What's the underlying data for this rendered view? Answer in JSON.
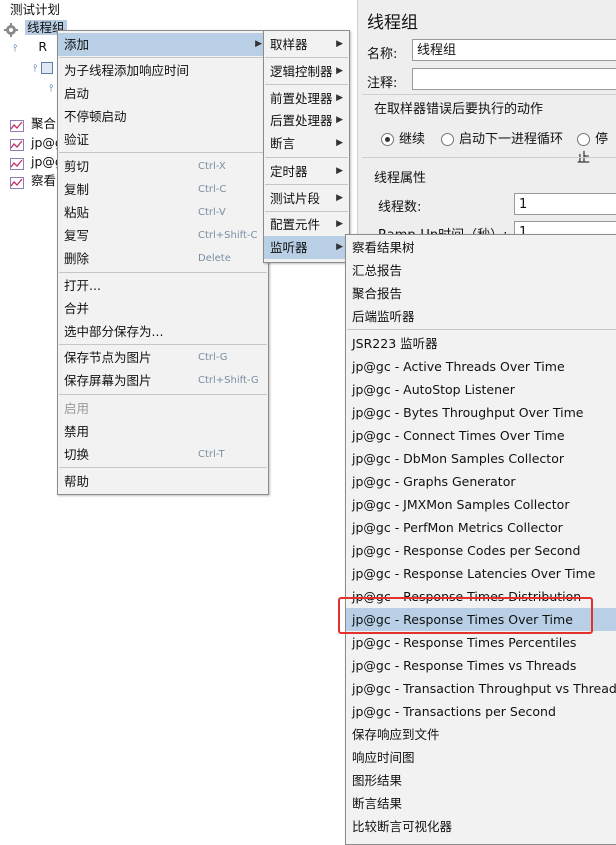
{
  "tree": {
    "items": [
      {
        "label": "测试计划"
      },
      {
        "label": "线程组"
      },
      {
        "label": "R"
      },
      {
        "label": ""
      },
      {
        "label": ""
      },
      {
        "label": "聚合"
      },
      {
        "label": "jp@g"
      },
      {
        "label": "jp@g"
      },
      {
        "label": "察看"
      }
    ]
  },
  "panel": {
    "title": "线程组",
    "name_label": "名称:",
    "name_value": "线程组",
    "comment_label": "注释:",
    "comment_value": "",
    "error_action_label": "在取样器错误后要执行的动作",
    "radio_continue": "继续",
    "radio_next_loop": "启动下一进程循环",
    "radio_stop": "停止",
    "thread_props_label": "线程属性",
    "threads_label": "线程数:",
    "threads_value": "1",
    "rampup_label": "Ramp-Up时间（秒）:",
    "rampup_value": "1"
  },
  "menu_main": {
    "items": [
      {
        "label": "添加"
      },
      {
        "label": "为子线程添加响应时间"
      },
      {
        "label": "启动"
      },
      {
        "label": "不停顿启动"
      },
      {
        "label": "验证"
      },
      {
        "label": "剪切",
        "shortcut": "Ctrl-X"
      },
      {
        "label": "复制",
        "shortcut": "Ctrl-C"
      },
      {
        "label": "粘贴",
        "shortcut": "Ctrl-V"
      },
      {
        "label": "复写",
        "shortcut": "Ctrl+Shift-C"
      },
      {
        "label": "删除",
        "shortcut": "Delete"
      },
      {
        "label": "打开..."
      },
      {
        "label": "合并"
      },
      {
        "label": "选中部分保存为..."
      },
      {
        "label": "保存节点为图片",
        "shortcut": "Ctrl-G"
      },
      {
        "label": "保存屏幕为图片",
        "shortcut": "Ctrl+Shift-G"
      },
      {
        "label": "启用"
      },
      {
        "label": "禁用"
      },
      {
        "label": "切换",
        "shortcut": "Ctrl-T"
      },
      {
        "label": "帮助"
      }
    ]
  },
  "menu_add": {
    "items": [
      {
        "label": "取样器"
      },
      {
        "label": "逻辑控制器"
      },
      {
        "label": "前置处理器"
      },
      {
        "label": "后置处理器"
      },
      {
        "label": "断言"
      },
      {
        "label": "定时器"
      },
      {
        "label": "测试片段"
      },
      {
        "label": "配置元件"
      },
      {
        "label": "监听器"
      }
    ]
  },
  "menu_listener": {
    "items": [
      {
        "label": "察看结果树"
      },
      {
        "label": "汇总报告"
      },
      {
        "label": "聚合报告"
      },
      {
        "label": "后端监听器"
      },
      {
        "label": "JSR223 监听器"
      },
      {
        "label": "jp@gc - Active Threads Over Time"
      },
      {
        "label": "jp@gc - AutoStop Listener"
      },
      {
        "label": "jp@gc - Bytes Throughput Over Time"
      },
      {
        "label": "jp@gc - Connect Times Over Time"
      },
      {
        "label": "jp@gc - DbMon Samples Collector"
      },
      {
        "label": "jp@gc - Graphs Generator"
      },
      {
        "label": "jp@gc - JMXMon Samples Collector"
      },
      {
        "label": "jp@gc - PerfMon Metrics Collector"
      },
      {
        "label": "jp@gc - Response Codes per Second"
      },
      {
        "label": "jp@gc - Response Latencies Over Time"
      },
      {
        "label": "jp@gc - Response Times Distribution"
      },
      {
        "label": "jp@gc - Response Times Over Time"
      },
      {
        "label": "jp@gc - Response Times Percentiles"
      },
      {
        "label": "jp@gc - Response Times vs Threads"
      },
      {
        "label": "jp@gc - Transaction Throughput vs Threads"
      },
      {
        "label": "jp@gc - Transactions per Second"
      },
      {
        "label": "保存响应到文件"
      },
      {
        "label": "响应时间图"
      },
      {
        "label": "图形结果"
      },
      {
        "label": "断言结果"
      },
      {
        "label": "比较断言可视化器"
      }
    ]
  },
  "colors": {
    "highlight": "#b8cfe5",
    "annotation_red": "#e5312e",
    "shortcut": "#7a8ea3"
  }
}
